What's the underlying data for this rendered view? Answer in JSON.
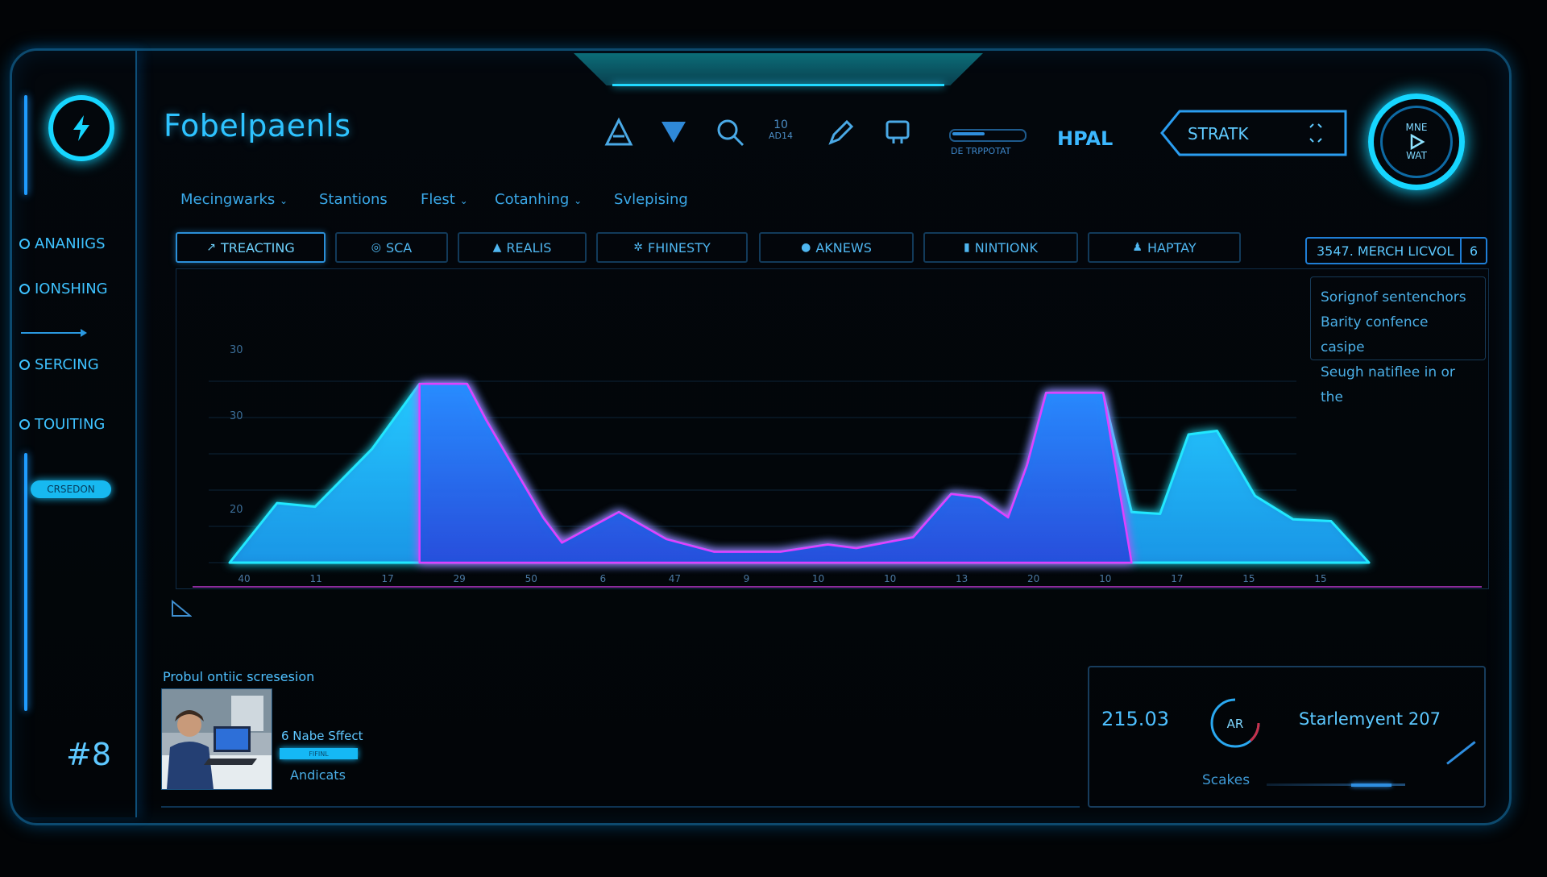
{
  "app": {
    "title": "Fobelpaenls"
  },
  "sidebar": {
    "items": [
      {
        "label": "ANANIIGS",
        "icon": "circle-icon"
      },
      {
        "label": "IONSHING",
        "icon": "circle-icon"
      },
      {
        "label": "SERCING",
        "icon": "circle-icon"
      },
      {
        "label": "TOUITING",
        "icon": "circle-icon"
      }
    ],
    "pill_label": "CRSEDON",
    "badge": "#8"
  },
  "toolbar": {
    "icons": [
      "triangle-outline-icon",
      "triangle-filled-icon",
      "search-icon",
      "grid-counter-icon",
      "pen-icon",
      "device-icon"
    ],
    "counter_text": [
      "10",
      "AD14"
    ],
    "slider": {
      "label": "DE TRPPOTAT",
      "value": 0.45
    },
    "hpal_label": "HPAL",
    "strat_label": "STRATK",
    "dial": {
      "top": "MNE",
      "bottom": "WAT"
    }
  },
  "menu": {
    "items": [
      {
        "label": "Mecingwarks",
        "has_dropdown": true
      },
      {
        "label": "Stantions",
        "has_dropdown": false
      },
      {
        "label": "Flest",
        "has_dropdown": true
      },
      {
        "label": "Cotanhing",
        "has_dropdown": true
      },
      {
        "label": "Svlepising",
        "has_dropdown": false
      }
    ]
  },
  "tabs": [
    {
      "label": "TREACTING",
      "icon": "chart-icon",
      "active": true
    },
    {
      "label": "SCA",
      "icon": "target-icon",
      "active": false
    },
    {
      "label": "REALIS",
      "icon": "user-icon",
      "active": false
    },
    {
      "label": "FHINESTY",
      "icon": "gear-icon",
      "active": false
    },
    {
      "label": "AKNEWS",
      "icon": "bullet-icon",
      "active": false
    },
    {
      "label": "NINTIONK",
      "icon": "bars-icon",
      "active": false
    },
    {
      "label": "HAPTAY",
      "icon": "person-icon",
      "active": false
    }
  ],
  "level_box": {
    "label": "3547. MERCH LICVOL",
    "count": "6"
  },
  "info_panel": {
    "lines": [
      "Sorignof sentenchors",
      "Barity confence casipe",
      "Seugh natiflee in or the"
    ]
  },
  "chart_data": {
    "type": "area",
    "x_tick_labels": [
      "40",
      "11",
      "17",
      "29",
      "50",
      "6",
      "47",
      "9",
      "10",
      "10",
      "13",
      "20",
      "10",
      "17",
      "15",
      "15"
    ],
    "y_tick_labels": [
      "30",
      "30",
      "20"
    ],
    "series": [
      {
        "values": [
          [
            0,
            0
          ],
          [
            0.05,
            0.33
          ],
          [
            0.09,
            0.31
          ],
          [
            0.15,
            0.63
          ],
          [
            0.2,
            0.99
          ],
          [
            0.25,
            0.99
          ],
          [
            0.27,
            0.79
          ],
          [
            0.33,
            0.25
          ],
          [
            0.35,
            0.11
          ],
          [
            0.41,
            0.28
          ],
          [
            0.46,
            0.13
          ],
          [
            0.51,
            0.06
          ],
          [
            0.58,
            0.06
          ],
          [
            0.63,
            0.1
          ],
          [
            0.66,
            0.08
          ],
          [
            0.72,
            0.14
          ],
          [
            0.76,
            0.38
          ],
          [
            0.79,
            0.36
          ],
          [
            0.82,
            0.25
          ],
          [
            0.84,
            0.54
          ],
          [
            0.86,
            0.94
          ],
          [
            0.92,
            0.94
          ],
          [
            0.95,
            0.28
          ],
          [
            0.98,
            0.27
          ],
          [
            1.01,
            0.71
          ],
          [
            1.04,
            0.73
          ],
          [
            1.08,
            0.37
          ],
          [
            1.12,
            0.24
          ],
          [
            1.16,
            0.23
          ],
          [
            1.2,
            0
          ]
        ],
        "color": "#1aa8ff"
      },
      {
        "values": [
          [
            0.2,
            0
          ],
          [
            0.2,
            0.99
          ],
          [
            0.25,
            0.99
          ],
          [
            0.27,
            0.79
          ],
          [
            0.33,
            0.25
          ],
          [
            0.35,
            0.11
          ],
          [
            0.41,
            0.28
          ],
          [
            0.46,
            0.13
          ],
          [
            0.51,
            0.06
          ],
          [
            0.58,
            0.06
          ],
          [
            0.63,
            0.1
          ],
          [
            0.66,
            0.08
          ],
          [
            0.72,
            0.14
          ],
          [
            0.76,
            0.38
          ],
          [
            0.79,
            0.36
          ],
          [
            0.82,
            0.25
          ],
          [
            0.84,
            0.54
          ],
          [
            0.86,
            0.94
          ],
          [
            0.92,
            0.94
          ],
          [
            0.95,
            0
          ]
        ],
        "color": "#e040ff"
      }
    ],
    "accent_colors": {
      "cyan": "#21e8ff",
      "magenta": "#e040ff",
      "blue": "#1a6cff"
    },
    "grid": true
  },
  "media": {
    "section_label": "Probul ontiic scresesion",
    "title": "6 Nabe Sffect",
    "bar_text": "FIFINL",
    "subtitle": "Andicats"
  },
  "stats": {
    "value": "215.03",
    "dial_text": "AR",
    "label": "Starlemyent 207",
    "caption": "Scakes",
    "progress": 0.9
  },
  "colors": {
    "accent": "#16d6ff",
    "border": "#0d4a6e",
    "background": "#020406"
  }
}
